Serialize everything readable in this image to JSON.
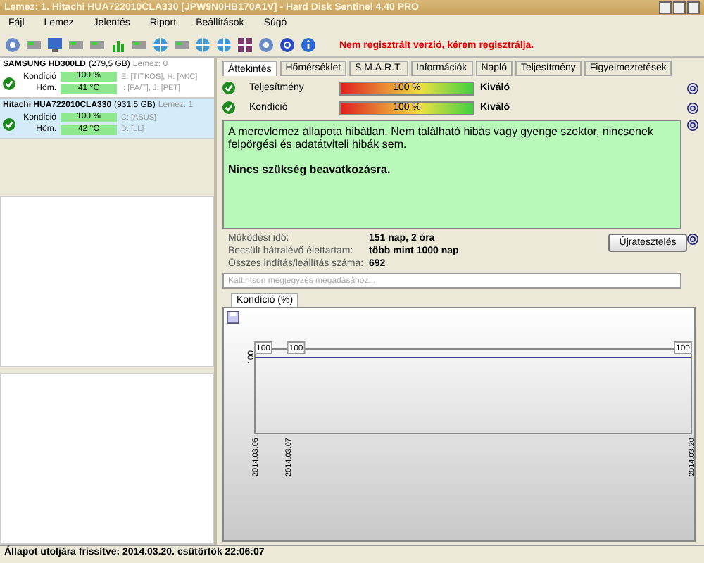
{
  "window": {
    "title": "Lemez: 1. Hitachi HUA722010CLA330 [JPW9N0HB170A1V]  -  Hard Disk Sentinel 4.40 PRO"
  },
  "menu": [
    "Fájl",
    "Lemez",
    "Jelentés",
    "Riport",
    "Beállítások",
    "Súgó"
  ],
  "notice": "Nem regisztrált verzió, kérem regisztrálja.",
  "disks": [
    {
      "name": "SAMSUNG HD300LD",
      "size": "(279,5 GB)",
      "index": "Lemez: 0",
      "selected": false,
      "condition_label": "Kondíció",
      "condition": "100 %",
      "temp_label": "Hőm.",
      "temp": "41 °C",
      "volumes_1": "E: [TITKOS], H: [AKC]",
      "volumes_2": "I: [PA/T], J: [PET]"
    },
    {
      "name": "Hitachi HUA722010CLA330",
      "size": "(931,5 GB)",
      "index": "Lemez: 1",
      "selected": true,
      "condition_label": "Kondíció",
      "condition": "100 %",
      "temp_label": "Hőm.",
      "temp": "42 °C",
      "volumes_1": "C: [ASUS]",
      "volumes_2": "D: [LL]"
    }
  ],
  "tabs": [
    {
      "label": "Áttekintés",
      "selected": true
    },
    {
      "label": "Hőmérséklet",
      "selected": false
    },
    {
      "label": "S.M.A.R.T.",
      "selected": false
    },
    {
      "label": "Információk",
      "selected": false
    },
    {
      "label": "Napló",
      "selected": false
    },
    {
      "label": "Teljesítmény",
      "selected": false
    },
    {
      "label": "Figyelmeztetések",
      "selected": false
    }
  ],
  "meters": [
    {
      "label": "Teljesítmény",
      "reading": "100 %",
      "level": 1,
      "rating": "Kiváló"
    },
    {
      "label": "Kondíció",
      "reading": "100 %",
      "level": 1,
      "rating": "Kiváló"
    }
  ],
  "status_text": "A merevlemez állapota hibátlan. Nem található hibás vagy gyenge szektor, nincsenek felpörgési és adatátviteli hibák sem.",
  "status_action": "Nincs szükség beavatkozásra.",
  "facts": [
    {
      "label": "Működési idő:",
      "value": "151 nap, 2 óra"
    },
    {
      "label": "Becsült hátralévő élettartam:",
      "value": "több mint 1000 nap"
    },
    {
      "label": "Összes indítás/leállítás száma:",
      "value": "692"
    }
  ],
  "retest_button": "Újratesztelés",
  "comment": {
    "placeholder": "Kattintson megjegyzés megadásához..."
  },
  "chart_tab": "Kondíció (%)",
  "condition_chart": {
    "axis_label": "100",
    "points": [
      {
        "date": "2014.03.06",
        "label": "100"
      },
      {
        "date": "2014.03.07",
        "label": "100"
      },
      {
        "date": "2014.03.20",
        "label": "100"
      }
    ]
  },
  "status_bar": "Állapot utoljára frissítve: 2014.03.20. csütörtök 22:06:07"
}
